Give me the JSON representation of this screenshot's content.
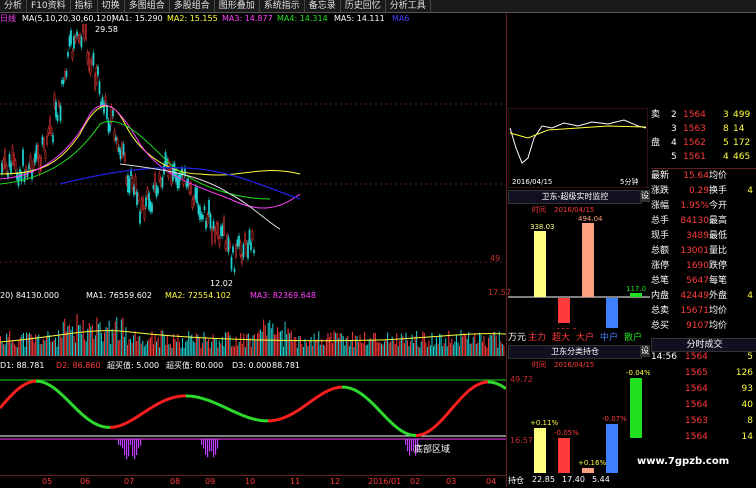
{
  "toolbar": {
    "items": [
      "分析",
      "F10资料",
      "指标",
      "切换",
      "多图组合",
      "多股组合",
      "图形叠加",
      "系统指示",
      "备忘录",
      "历史回忆",
      "分析工具"
    ]
  },
  "main_chart": {
    "legend": [
      {
        "label": "日线",
        "color": "#ff40ff"
      },
      {
        "label": "MA(5,10,20,30,60,120)",
        "color": "#ffffff"
      },
      {
        "label": "MA1: 15.290",
        "color": "#ffffff"
      },
      {
        "label": "MA2: 15.155",
        "color": "#ffff40"
      },
      {
        "label": "MA3: 14.877",
        "color": "#ff40ff"
      },
      {
        "label": "MA4: 14.314",
        "color": "#20e020"
      },
      {
        "label": "MA5: 14.111",
        "color": "#ffffff"
      },
      {
        "label": "MA6",
        "color": "#4040ff"
      }
    ],
    "high_label": "29.58",
    "low_label": "12.02",
    "axis_labels": [
      "49",
      "17.57"
    ]
  },
  "volume_chart": {
    "legend": [
      {
        "label": "20) 84130.000",
        "color": "#ffffff"
      },
      {
        "label": "MA1: 76559.602",
        "color": "#ffffff"
      },
      {
        "label": "MA2: 72554.102",
        "color": "#ffff40"
      },
      {
        "label": "MA3: 82369.648",
        "color": "#ff40ff"
      }
    ]
  },
  "indicator_chart": {
    "legend": [
      {
        "label": "D1: 88.781",
        "color": "#ffffff"
      },
      {
        "label": "D2: 86.860",
        "color": "#ff3a3a"
      },
      {
        "label": "超买值: 5.000",
        "color": "#ffffff"
      },
      {
        "label": "超买值: 80.000",
        "color": "#ffffff"
      },
      {
        "label": "D3: 0.000",
        "color": "#ffffff"
      },
      {
        "label": "88.781",
        "color": "#ffffff"
      }
    ],
    "annotation": "底部区域",
    "axis_labels": [
      "49.72",
      "16.57"
    ]
  },
  "date_axis": [
    "05",
    "06",
    "07",
    "08",
    "09",
    "10",
    "11",
    "12",
    "2016/01",
    "02",
    "03",
    "04"
  ],
  "mini_chart": {
    "date": "2016/04/15",
    "period": "5分钟"
  },
  "super_monitor": {
    "title": "卫东-超级实时监控",
    "time_label": "时间",
    "date": "2016/04/15",
    "values": [
      {
        "label": "338.03",
        "color": "#ffff80"
      },
      {
        "label": "-156.6",
        "color": "#ff3a3a"
      },
      {
        "label": "494.04",
        "color": "#ffa080"
      },
      {
        "label": "-221.0",
        "color": "#4080ff"
      },
      {
        "label": "117.0",
        "color": "#20e020"
      }
    ],
    "categories": [
      "万元",
      "主力",
      "超大",
      "大户",
      "中户",
      "散户"
    ]
  },
  "holding_monitor": {
    "title": "卫东分类持仓",
    "time_label": "时间",
    "date": "2016/04/15",
    "values": [
      "+0.11%",
      "-0.05%",
      "+0.16%",
      "-0.07%",
      "-0.04%"
    ],
    "bottom_values": [
      "22.85",
      "17.40",
      "5.44"
    ],
    "bottom_label": "持仓"
  },
  "order_book": [
    {
      "side": "卖",
      "level": "2",
      "price": "1564",
      "vol": "3",
      "extra": "499"
    },
    {
      "side": "",
      "level": "3",
      "price": "1563",
      "vol": "8",
      "extra": "14"
    },
    {
      "side": "盘",
      "level": "4",
      "price": "1562",
      "vol": "5",
      "extra": "172"
    },
    {
      "side": "",
      "level": "5",
      "price": "1561",
      "vol": "4",
      "extra": "465"
    }
  ],
  "quote_rows": [
    {
      "k1": "最新",
      "v1": "15.64",
      "k2": "均价",
      "v2": ""
    },
    {
      "k1": "涨跌",
      "v1": "0.29",
      "k2": "换手",
      "v2": "4"
    },
    {
      "k1": "涨幅",
      "v1": "1.95%",
      "k2": "今开",
      "v2": ""
    },
    {
      "k1": "总手",
      "v1": "84130",
      "k2": "最高",
      "v2": ""
    },
    {
      "k1": "现手",
      "v1": "3489",
      "k2": "最低",
      "v2": ""
    },
    {
      "k1": "总额",
      "v1": "13001",
      "k2": "量比",
      "v2": ""
    },
    {
      "k1": "涨停",
      "v1": "1690",
      "k2": "跌停",
      "v2": ""
    },
    {
      "k1": "总笔",
      "v1": "5647",
      "k2": "每笔",
      "v2": ""
    },
    {
      "k1": "内盘",
      "v1": "42449",
      "k2": "外盘",
      "v2": "4"
    },
    {
      "k1": "总卖",
      "v1": "15671",
      "k2": "均价",
      "v2": ""
    },
    {
      "k1": "总买",
      "v1": "9107",
      "k2": "均价",
      "v2": ""
    }
  ],
  "time_sales": {
    "title": "分时成交",
    "rows": [
      {
        "time": "14:56",
        "price": "1564",
        "vol": "5"
      },
      {
        "time": "",
        "price": "1565",
        "vol": "126"
      },
      {
        "time": "",
        "price": "1564",
        "vol": "93"
      },
      {
        "time": "",
        "price": "1564",
        "vol": "40"
      },
      {
        "time": "",
        "price": "1563",
        "vol": "8"
      },
      {
        "time": "",
        "price": "1564",
        "vol": "14"
      }
    ]
  },
  "watermark": "www.7gpzb.com"
}
